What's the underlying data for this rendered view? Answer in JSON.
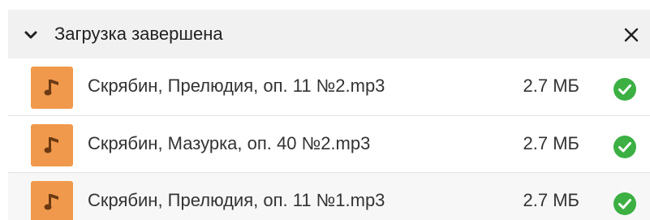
{
  "header": {
    "title": "Загрузка завершена",
    "background": "#f1f1f1"
  },
  "icons": {
    "collapse": "chevron-down-icon",
    "close": "close-icon",
    "file": "music-note-icon",
    "status": "check-circle-icon"
  },
  "colors": {
    "file_icon_bg": "#f0994c",
    "check_green": "#3cb043"
  },
  "files": [
    {
      "name": "Скрябин, Прелюдия, оп. 11 №2.mp3",
      "size": "2.7 МБ",
      "status": "done"
    },
    {
      "name": "Скрябин, Мазурка, оп. 40 №2.mp3",
      "size": "2.7 МБ",
      "status": "done"
    },
    {
      "name": "Скрябин, Прелюдия, оп. 11 №1.mp3",
      "size": "2.7 МБ",
      "status": "done"
    }
  ]
}
